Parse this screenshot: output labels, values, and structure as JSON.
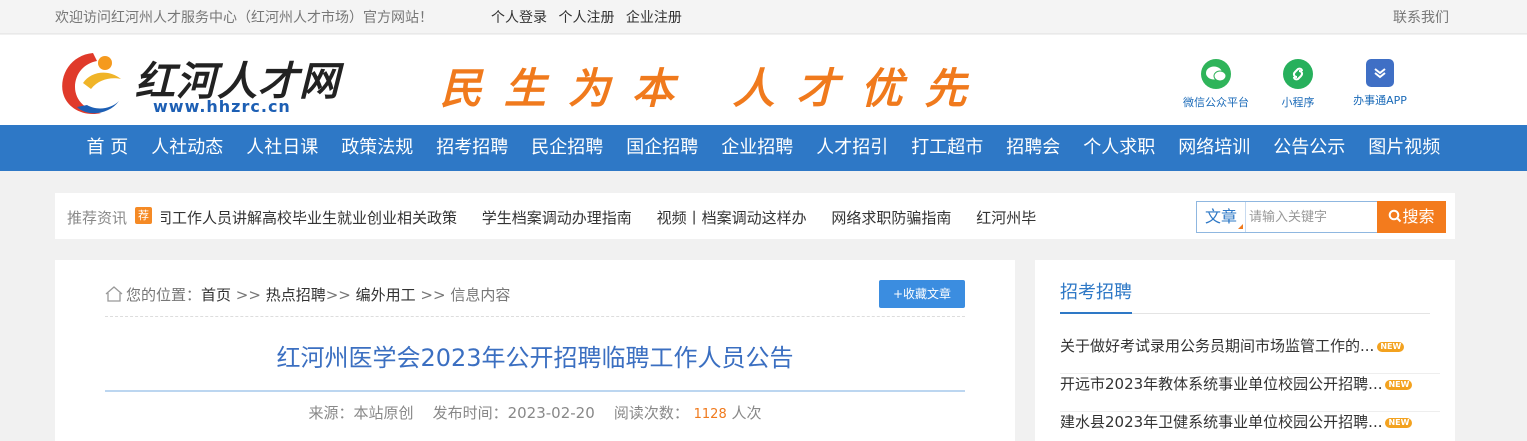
{
  "topbar": {
    "welcome": "欢迎访问红河州人才服务中心（红河州人才市场）官方网站！",
    "links": [
      "个人登录",
      "个人注册",
      "企业注册"
    ],
    "contact": "联系我们"
  },
  "header": {
    "logo_name": "红河人才网",
    "logo_url": "www.hhzrc.cn",
    "slogan": "民生为本 人才优先",
    "apps": [
      {
        "label": "微信公众平台",
        "icon": "wechat-icon",
        "color": "#2fb45a"
      },
      {
        "label": "小程序",
        "icon": "miniprogram-icon",
        "color": "#27b05c"
      },
      {
        "label": "办事通APP",
        "icon": "app-icon",
        "color": "#3f6fc5"
      }
    ]
  },
  "nav": {
    "items": [
      "首 页",
      "人社动态",
      "人社日课",
      "政策法规",
      "招考招聘",
      "民企招聘",
      "国企招聘",
      "企业招聘",
      "人才招引",
      "打工超市",
      "招聘会",
      "个人求职",
      "网络培训",
      "公告公示",
      "图片视频"
    ]
  },
  "recommend": {
    "label": "推荐资讯",
    "badge": "荐",
    "items": [
      "司工作人员讲解高校毕业生就业创业相关政策",
      "学生档案调动办理指南",
      "视频丨档案调动这样办",
      "网络求职防骗指南",
      "红河州毕"
    ]
  },
  "search": {
    "type": "文章",
    "placeholder": "请输入关键字",
    "button": "搜索"
  },
  "article": {
    "breadcrumb_prefix": "您的位置：",
    "breadcrumb": [
      "首页",
      " >> ",
      "热点招聘",
      ">> ",
      "编外用工",
      " >> ",
      "信息内容"
    ],
    "favorite_button": "收藏文章",
    "title": "红河州医学会2023年公开招聘临聘工作人员公告",
    "source_label": "来源：",
    "source": "本站原创",
    "date_label": "发布时间：",
    "date": "2023-02-20",
    "views_label": "阅读次数：",
    "views": "1128",
    "views_unit": "人次"
  },
  "sidebar": {
    "heading": "招考招聘",
    "items": [
      {
        "text": "关于做好考试录用公务员期间市场监管工作的...",
        "badge": "NEW"
      },
      {
        "text": "开远市2023年教体系统事业单位校园公开招聘...",
        "badge": "NEW"
      },
      {
        "text": "建水县2023年卫健系统事业单位校园公开招聘...",
        "badge": "NEW"
      }
    ]
  },
  "colors": {
    "nav_bg": "#2e78c6",
    "slogan": "#f07a1d",
    "search_button": "#f37b1d",
    "title": "#3b6fc1"
  }
}
